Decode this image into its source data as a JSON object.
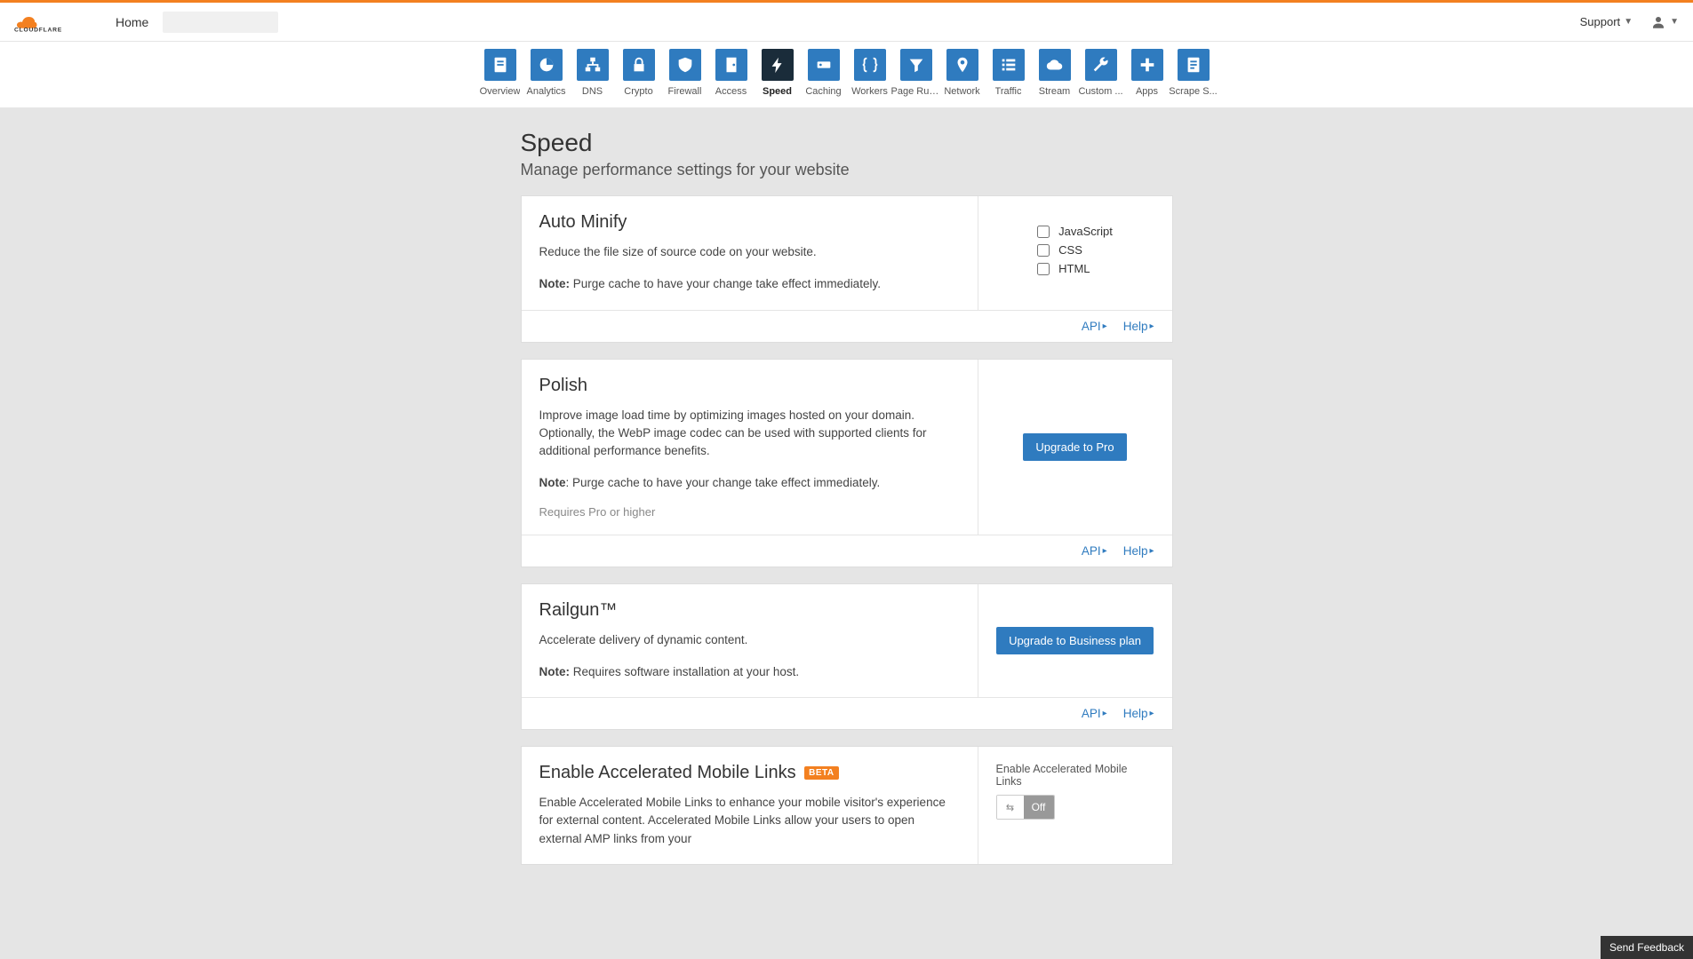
{
  "header": {
    "home": "Home",
    "support": "Support"
  },
  "tabs": [
    {
      "label": "Overview",
      "icon": "doc"
    },
    {
      "label": "Analytics",
      "icon": "pie"
    },
    {
      "label": "DNS",
      "icon": "tree"
    },
    {
      "label": "Crypto",
      "icon": "lock"
    },
    {
      "label": "Firewall",
      "icon": "shield"
    },
    {
      "label": "Access",
      "icon": "door"
    },
    {
      "label": "Speed",
      "icon": "bolt",
      "active": true
    },
    {
      "label": "Caching",
      "icon": "drive"
    },
    {
      "label": "Workers",
      "icon": "braces"
    },
    {
      "label": "Page Rules",
      "icon": "funnel"
    },
    {
      "label": "Network",
      "icon": "pin"
    },
    {
      "label": "Traffic",
      "icon": "list"
    },
    {
      "label": "Stream",
      "icon": "cloud"
    },
    {
      "label": "Custom ...",
      "icon": "wrench"
    },
    {
      "label": "Apps",
      "icon": "plus"
    },
    {
      "label": "Scrape S...",
      "icon": "page"
    }
  ],
  "page": {
    "title": "Speed",
    "subtitle": "Manage performance settings for your website"
  },
  "links": {
    "api": "API",
    "help": "Help"
  },
  "auto_minify": {
    "title": "Auto Minify",
    "desc": "Reduce the file size of source code on your website.",
    "note_label": "Note:",
    "note_text": " Purge cache to have your change take effect immediately.",
    "options": [
      "JavaScript",
      "CSS",
      "HTML"
    ]
  },
  "polish": {
    "title": "Polish",
    "desc": "Improve image load time by optimizing images hosted on your domain. Optionally, the WebP image codec can be used with supported clients for additional performance benefits.",
    "note_label": "Note",
    "note_text": ": Purge cache to have your change take effect immediately.",
    "requires": "Requires Pro or higher",
    "button": "Upgrade to Pro"
  },
  "railgun": {
    "title": "Railgun™",
    "desc": "Accelerate delivery of dynamic content.",
    "note_label": "Note:",
    "note_text": " Requires software installation at your host.",
    "button": "Upgrade to Business plan"
  },
  "aml": {
    "title": "Enable Accelerated Mobile Links",
    "badge": "BETA",
    "desc": "Enable Accelerated Mobile Links to enhance your mobile visitor's experience for external content. Accelerated Mobile Links allow your users to open external AMP links from your",
    "side_label": "Enable Accelerated Mobile Links",
    "toggle_off": "Off"
  },
  "feedback": "Send Feedback"
}
